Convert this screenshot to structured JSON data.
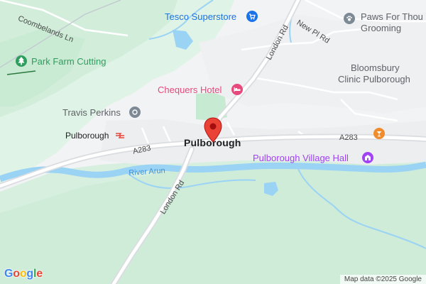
{
  "map": {
    "place": "Pulborough",
    "attribution": "Map data ©2025 Google",
    "logo_letters": [
      "G",
      "o",
      "o",
      "g",
      "l",
      "e"
    ],
    "logo_colors": [
      "#4285F4",
      "#EA4335",
      "#FBBC05",
      "#4285F4",
      "#34A853",
      "#EA4335"
    ],
    "colors": {
      "land": "#f1f3f4",
      "park": "#d9f1e1",
      "park_dark": "#c7ead2",
      "water": "#9bd3f5",
      "road_major": "#dadce0",
      "road_minor": "#ffffff",
      "pin": "#ea4335",
      "shop_poi": "#1a73e8",
      "hotel_poi": "#e8497c",
      "venue_poi": "#a142f4",
      "gray_poi": "#7d8a95",
      "park_poi": "#2e9e5e"
    },
    "pois": {
      "tesco": {
        "label": "Tesco Superstore",
        "icon": "shopping-cart-icon"
      },
      "paws": {
        "label_line1": "Paws For Thou",
        "label_line2": "Grooming",
        "icon": "paw-icon"
      },
      "park_farm": {
        "label": "Park Farm Cutting",
        "icon": "tree-icon"
      },
      "bloomsbury": {
        "label_line1": "Bloomsbury",
        "label_line2": "Clinic Pulborough"
      },
      "chequers": {
        "label": "Chequers Hotel",
        "icon": "bed-icon"
      },
      "travis": {
        "label": "Travis Perkins",
        "icon": "store-icon"
      },
      "station": {
        "label": "Pulborough",
        "icon": "rail-icon"
      },
      "village_hall": {
        "label": "Pulborough Village Hall",
        "icon": "building-icon"
      },
      "bar": {
        "icon": "cocktail-icon"
      }
    },
    "roads": {
      "coombelands": "Coombelands Ln",
      "london_rd_north": "London Rd",
      "new_pl_rd": "New Pl Rd",
      "a283_west": "A283",
      "a283_east": "A283",
      "london_rd_south": "London Rd"
    },
    "water": {
      "river": "River Arun"
    }
  }
}
